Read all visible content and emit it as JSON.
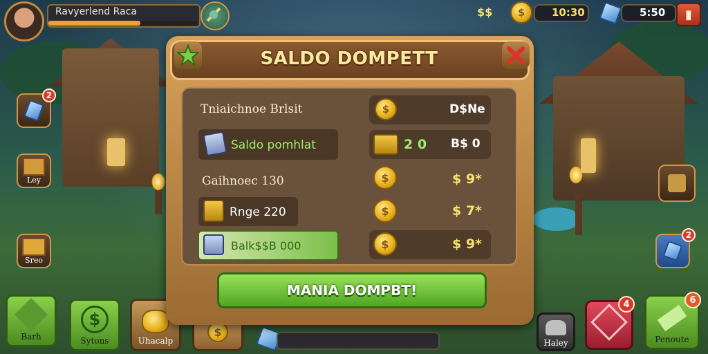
{
  "player": {
    "name": "Ravyerlend Raca",
    "xp_progress": 0.62
  },
  "hud": {
    "cash": "$$",
    "coins": "10:30",
    "gems": "5:50"
  },
  "colors": {
    "accent_green": "#4ea522",
    "gold": "#f7e36b",
    "wood": "#8a5a2f",
    "close_red": "#d83a2a"
  },
  "side_left": [
    {
      "icon": "gem-icon",
      "badge": "2",
      "label": ""
    },
    {
      "icon": "crate-icon",
      "badge": "",
      "label": "Ley"
    },
    {
      "icon": "crate-icon",
      "badge": "",
      "label": "Sreo"
    }
  ],
  "side_right": [
    {
      "icon": "map-icon",
      "badge": ""
    },
    {
      "icon": "gem-icon",
      "badge": "2"
    }
  ],
  "bottom_bar": [
    {
      "icon": "hammer-icon",
      "label": "Barh"
    },
    {
      "icon": "dollar-icon",
      "label": "Sytons"
    },
    {
      "icon": "coins-icon",
      "label": "Uhacalp"
    },
    {
      "icon": "coin-icon",
      "label": ""
    },
    {
      "icon": "helmet-icon",
      "label": "Haley"
    },
    {
      "icon": "card-icon",
      "label": "",
      "badge": "4"
    },
    {
      "icon": "ticket-icon",
      "label": "Penoute",
      "badge": "6"
    }
  ],
  "dialog": {
    "title": "SALDO DOMPETT",
    "rows": [
      {
        "label": "Tniaichnoe Brlsit",
        "amount": "",
        "value": "D$Ne"
      },
      {
        "label": "Saldo pomhlat",
        "amount": "2 0",
        "value": "B$ 0"
      },
      {
        "label": "Gaihnoec 130",
        "amount": "",
        "value": "$ 9*"
      },
      {
        "label": "Rnge 220",
        "amount": "",
        "value": "$ 7*"
      },
      {
        "label": "Balk$$B 000",
        "amount": "",
        "value": "$ 9*"
      }
    ],
    "cta_label": "MANIA DOMPBT!"
  }
}
